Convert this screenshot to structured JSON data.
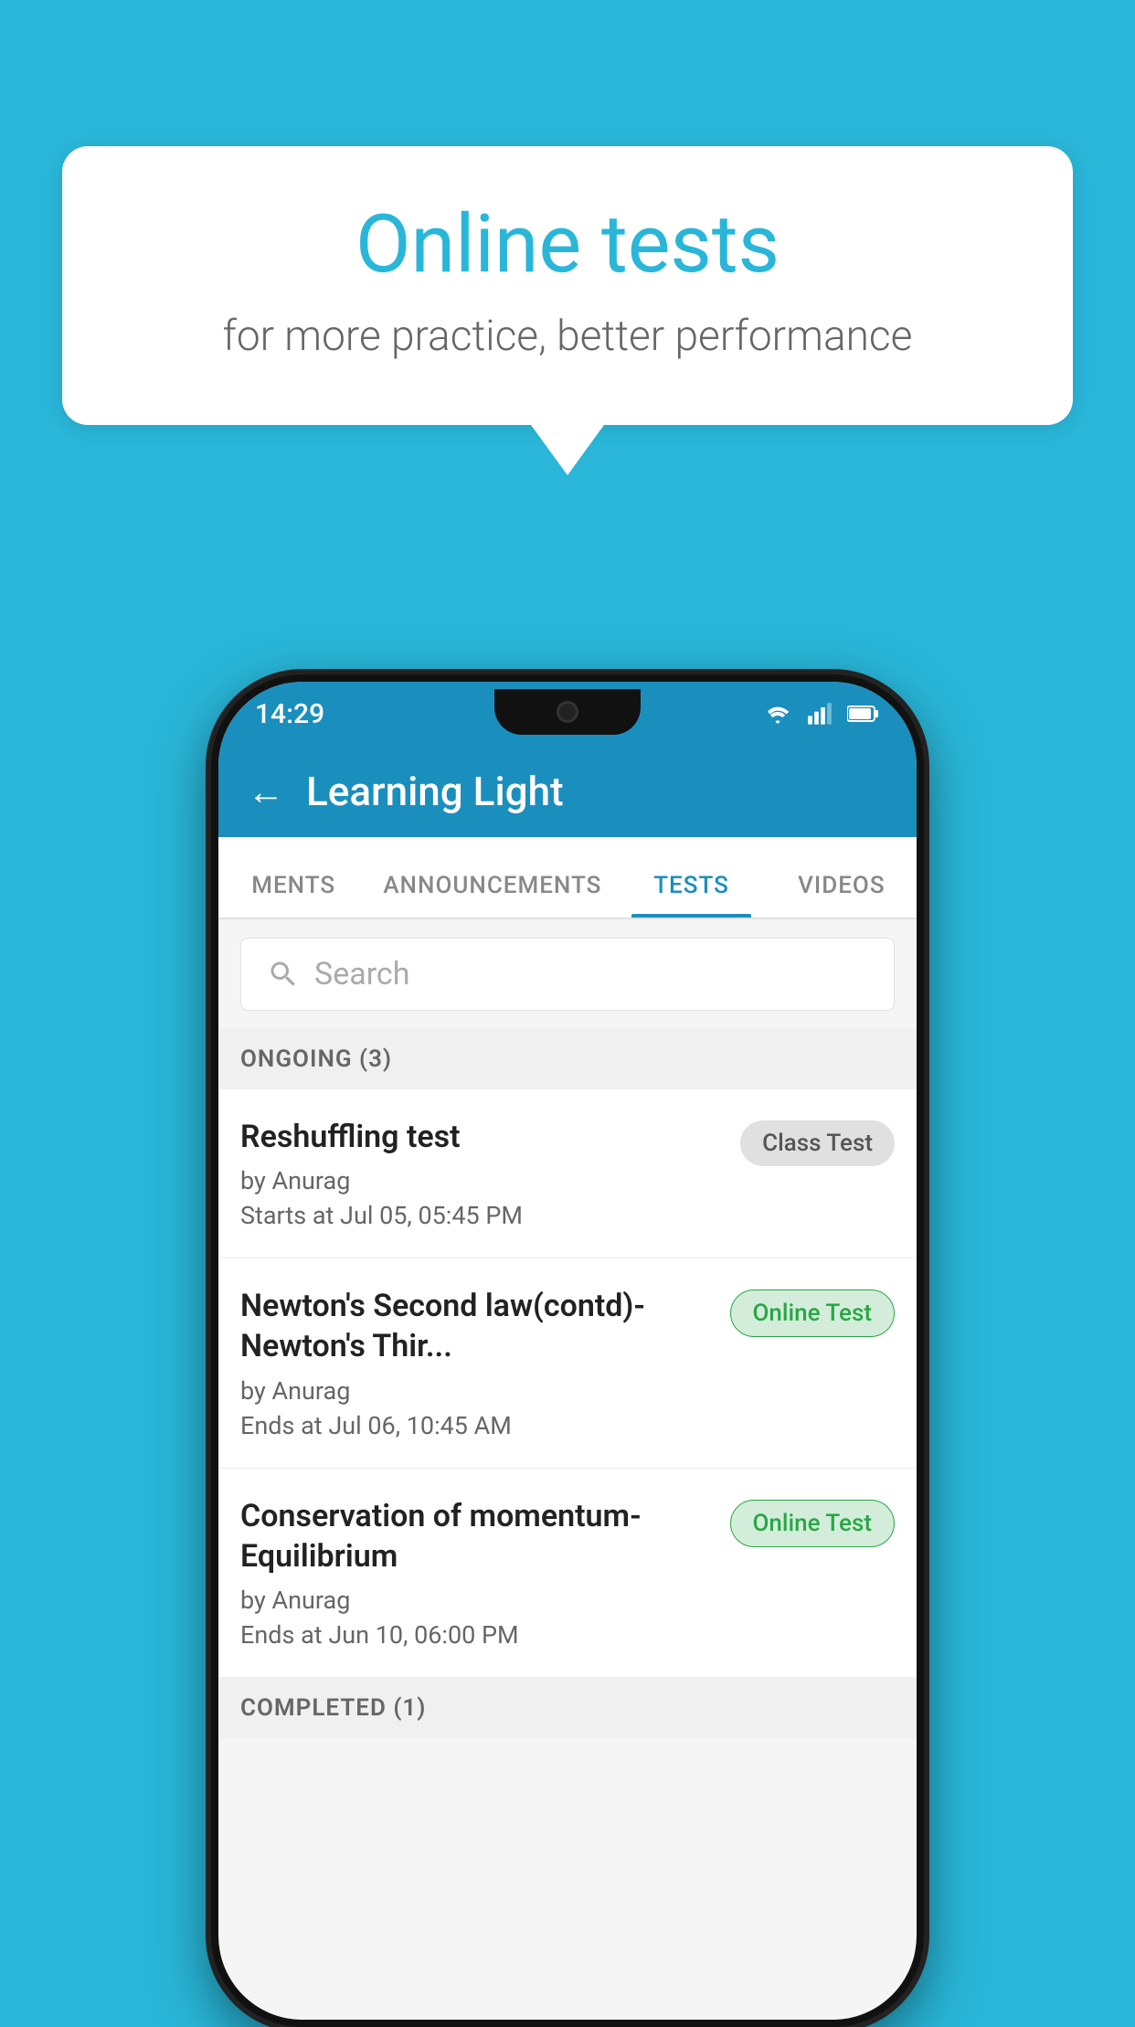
{
  "background_color": "#29b6d8",
  "bubble": {
    "title": "Online tests",
    "subtitle": "for more practice, better performance"
  },
  "status_bar": {
    "time": "14:29",
    "wifi_icon": "wifi",
    "signal_icon": "signal",
    "battery_icon": "battery"
  },
  "app_bar": {
    "back_label": "←",
    "title": "Learning Light"
  },
  "tabs": [
    {
      "label": "MENTS",
      "active": false
    },
    {
      "label": "ANNOUNCEMENTS",
      "active": false
    },
    {
      "label": "TESTS",
      "active": true
    },
    {
      "label": "VIDEOS",
      "active": false
    }
  ],
  "search": {
    "placeholder": "Search"
  },
  "sections": [
    {
      "header": "ONGOING (3)",
      "tests": [
        {
          "name": "Reshuffling test",
          "by": "by Anurag",
          "time": "Starts at  Jul 05, 05:45 PM",
          "badge": "Class Test",
          "badge_type": "class"
        },
        {
          "name": "Newton's Second law(contd)-Newton's Thir...",
          "by": "by Anurag",
          "time": "Ends at  Jul 06, 10:45 AM",
          "badge": "Online Test",
          "badge_type": "online"
        },
        {
          "name": "Conservation of momentum-Equilibrium",
          "by": "by Anurag",
          "time": "Ends at  Jun 10, 06:00 PM",
          "badge": "Online Test",
          "badge_type": "online"
        }
      ]
    }
  ],
  "completed_header": "COMPLETED (1)"
}
